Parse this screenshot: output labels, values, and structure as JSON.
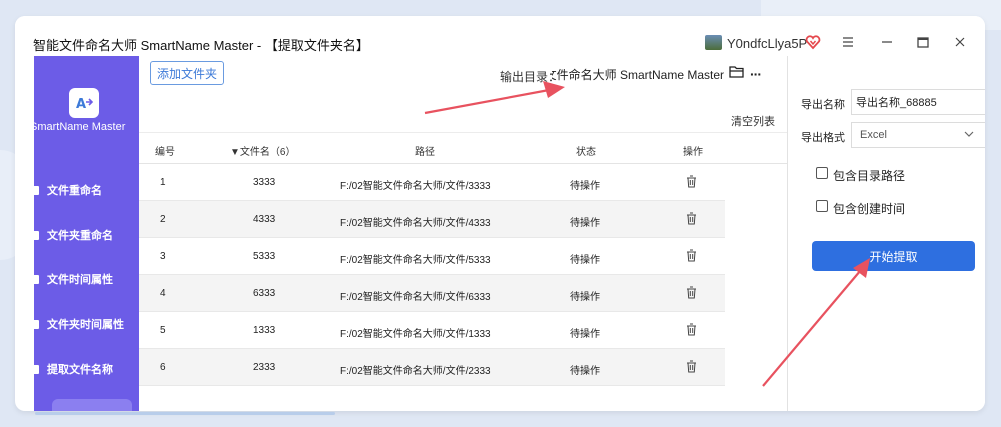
{
  "window": {
    "title": "智能文件命名大师 SmartName Master - 【提取文件夹名】",
    "user_name": "Y0ndfcLlya5P"
  },
  "sidebar": {
    "app_name": "SmartName Master",
    "items": [
      {
        "label": "文件重命名"
      },
      {
        "label": "文件夹重命名"
      },
      {
        "label": "文件时间属性"
      },
      {
        "label": "文件夹时间属性"
      },
      {
        "label": "提取文件名称"
      }
    ]
  },
  "toolbar": {
    "add_folder_label": "添加文件夹",
    "output_dir_label": "输出目录：",
    "output_dir_value": "能文件命名大师 SmartName Master",
    "more_label": "···",
    "clear_list_label": "清空列表"
  },
  "table": {
    "headers": {
      "index": "编号",
      "filename": "文件名（6）",
      "path": "路径",
      "status": "状态",
      "action": "操作"
    },
    "rows": [
      {
        "index": "1",
        "filename": "3333",
        "path": "F:/02智能文件命名大师/文件/3333",
        "status": "待操作"
      },
      {
        "index": "2",
        "filename": "4333",
        "path": "F:/02智能文件命名大师/文件/4333",
        "status": "待操作"
      },
      {
        "index": "3",
        "filename": "5333",
        "path": "F:/02智能文件命名大师/文件/5333",
        "status": "待操作"
      },
      {
        "index": "4",
        "filename": "6333",
        "path": "F:/02智能文件命名大师/文件/6333",
        "status": "待操作"
      },
      {
        "index": "5",
        "filename": "1333",
        "path": "F:/02智能文件命名大师/文件/1333",
        "status": "待操作"
      },
      {
        "index": "6",
        "filename": "2333",
        "path": "F:/02智能文件命名大师/文件/2333",
        "status": "待操作"
      }
    ]
  },
  "right_panel": {
    "export_name_label": "导出名称",
    "export_name_value": "导出名称_68885",
    "export_format_label": "导出格式",
    "export_format_value": "Excel",
    "include_dir_path_label": "包含目录路径",
    "include_create_time_label": "包含创建时间",
    "start_button_label": "开始提取"
  },
  "colors": {
    "sidebar_bg": "#6c5ce7",
    "primary_button": "#2e6fe0",
    "annotation_arrow": "#e8525f"
  }
}
